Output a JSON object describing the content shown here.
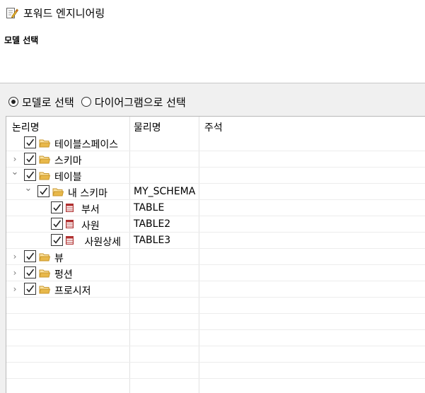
{
  "header": {
    "title": "포워드 엔지니어링",
    "title_icon": "edit-document-icon",
    "subtitle": "모델 선택"
  },
  "selection_mode": {
    "options": [
      {
        "label": "모델로 선택",
        "selected": true
      },
      {
        "label": "다이어그램으로 선택",
        "selected": false
      }
    ]
  },
  "tree": {
    "columns": [
      "논리명",
      "물리명",
      "주석"
    ],
    "rows": [
      {
        "label": "테이블스페이스",
        "physical": "",
        "comment": "",
        "depth": 0,
        "expander": "none",
        "checked": true,
        "icon": "folder-icon"
      },
      {
        "label": "스키마",
        "physical": "",
        "comment": "",
        "depth": 0,
        "expander": "collapsed",
        "checked": true,
        "icon": "folder-icon"
      },
      {
        "label": "테이블",
        "physical": "",
        "comment": "",
        "depth": 0,
        "expander": "expanded",
        "checked": true,
        "icon": "folder-icon"
      },
      {
        "label": "내 스키마",
        "physical": "MY_SCHEMA",
        "comment": "",
        "depth": 1,
        "expander": "expanded",
        "checked": true,
        "icon": "folder-icon"
      },
      {
        "label": "부서",
        "physical": "TABLE",
        "comment": "",
        "depth": 2,
        "expander": "none",
        "checked": true,
        "icon": "table-icon"
      },
      {
        "label": "사원",
        "physical": "TABLE2",
        "comment": "",
        "depth": 2,
        "expander": "none",
        "checked": true,
        "icon": "table-icon"
      },
      {
        "label": " 사원상세",
        "physical": "TABLE3",
        "comment": "",
        "depth": 2,
        "expander": "none",
        "checked": true,
        "icon": "table-icon"
      },
      {
        "label": "뷰",
        "physical": "",
        "comment": "",
        "depth": 0,
        "expander": "collapsed",
        "checked": true,
        "icon": "folder-icon"
      },
      {
        "label": "펑션",
        "physical": "",
        "comment": "",
        "depth": 0,
        "expander": "collapsed",
        "checked": true,
        "icon": "folder-icon"
      },
      {
        "label": "프로시저",
        "physical": "",
        "comment": "",
        "depth": 0,
        "expander": "collapsed",
        "checked": true,
        "icon": "folder-icon"
      }
    ],
    "empty_rows": 6
  },
  "colors": {
    "folder": "#e8b84a",
    "table_icon": "#b03030"
  }
}
